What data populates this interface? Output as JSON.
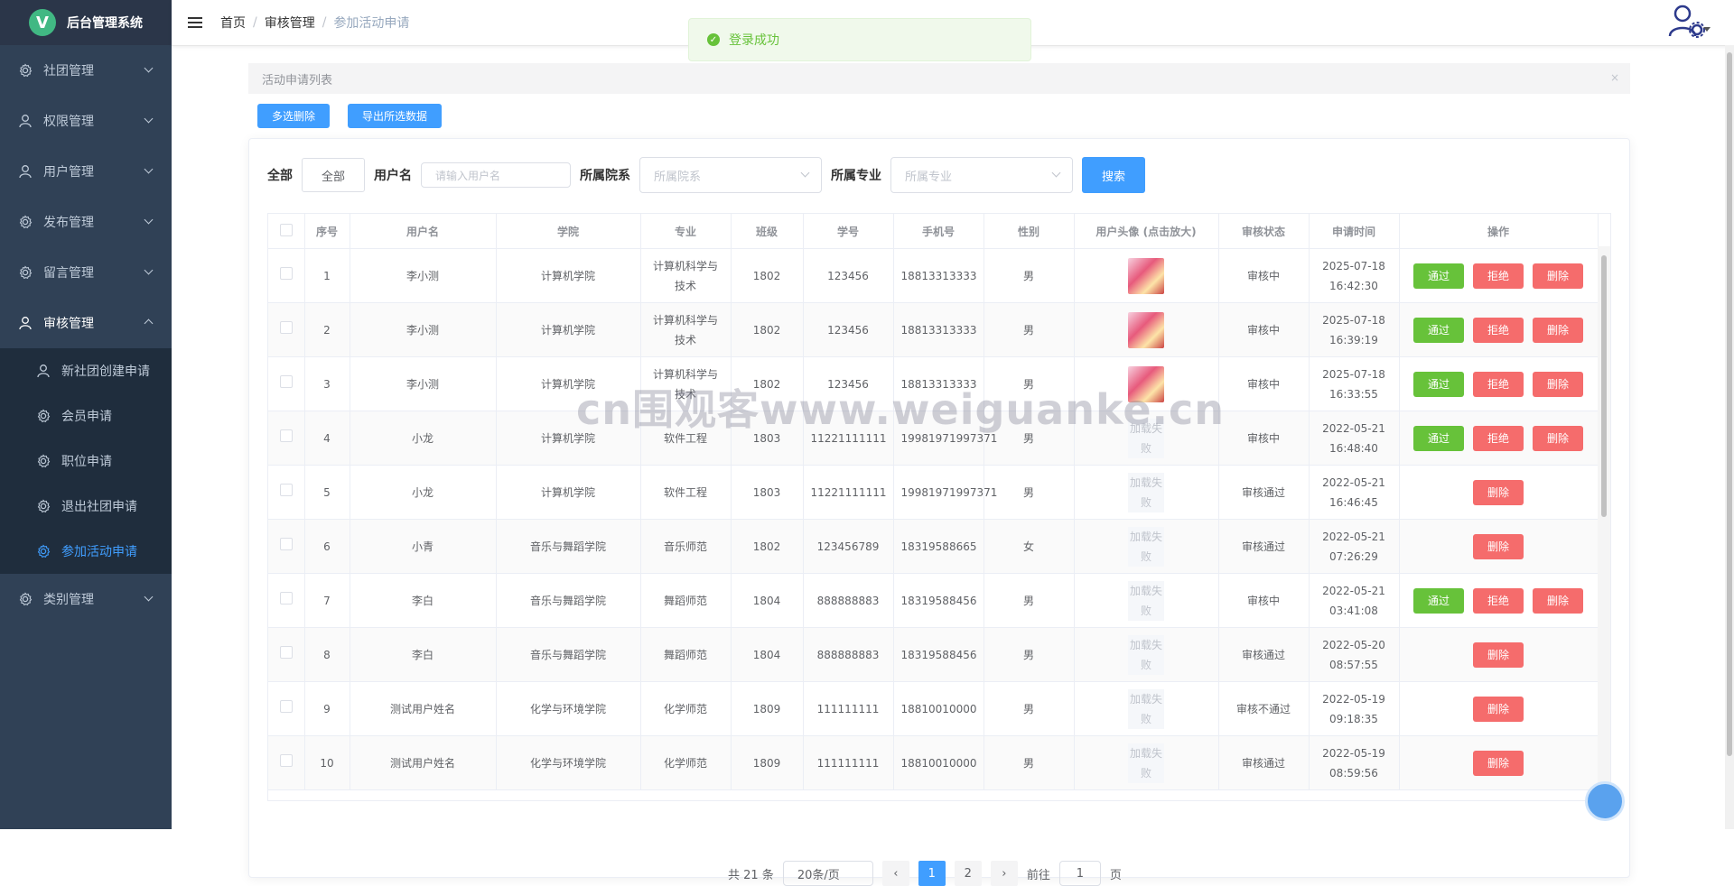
{
  "app": {
    "title": "后台管理系统",
    "logo_letter": "V"
  },
  "sidebar": {
    "items": [
      {
        "label": "社团管理",
        "icon": "gear-icon",
        "open": false
      },
      {
        "label": "权限管理",
        "icon": "user-icon",
        "open": false
      },
      {
        "label": "用户管理",
        "icon": "user-icon",
        "open": false
      },
      {
        "label": "发布管理",
        "icon": "gear-icon",
        "open": false
      },
      {
        "label": "留言管理",
        "icon": "gear-icon",
        "open": false
      },
      {
        "label": "审核管理",
        "icon": "user-icon",
        "open": true
      },
      {
        "label": "类别管理",
        "icon": "gear-icon",
        "open": false
      }
    ],
    "sub_items": [
      {
        "label": "新社团创建申请",
        "icon": "user-icon"
      },
      {
        "label": "会员申请",
        "icon": "gear-icon"
      },
      {
        "label": "职位申请",
        "icon": "gear-icon"
      },
      {
        "label": "退出社团申请",
        "icon": "gear-icon"
      },
      {
        "label": "参加活动申请",
        "icon": "gear-icon",
        "active": true
      }
    ]
  },
  "breadcrumb": [
    "首页",
    "审核管理",
    "参加活动申请"
  ],
  "toast": {
    "text": "登录成功"
  },
  "panel": {
    "title": "活动申请列表",
    "close": "×"
  },
  "toolbar": {
    "batch_delete": "多选删除",
    "export": "导出所选数据"
  },
  "filters": {
    "all_label": "全部",
    "all_button": "全部",
    "username_label": "用户名",
    "username_placeholder": "请输入用户名",
    "college_label": "所属院系",
    "college_placeholder": "所属院系",
    "major_label": "所属专业",
    "major_placeholder": "所属专业",
    "search_button": "搜索"
  },
  "table": {
    "headers": [
      "序号",
      "用户名",
      "学院",
      "专业",
      "班级",
      "学号",
      "手机号",
      "性别",
      "用户头像 (点击放大)",
      "审核状态",
      "申请时间",
      "操作"
    ],
    "rows": [
      {
        "no": "1",
        "user": "李小测",
        "college": "计算机学院",
        "major": "计算机科学与技术",
        "cls": "1802",
        "sid": "123456",
        "phone": "18813313333",
        "gender": "男",
        "avatar": "image",
        "status": "审核中",
        "time": "2025-07-18 16:42:30",
        "ops": [
          "通过",
          "拒绝",
          "删除"
        ]
      },
      {
        "no": "2",
        "user": "李小测",
        "college": "计算机学院",
        "major": "计算机科学与技术",
        "cls": "1802",
        "sid": "123456",
        "phone": "18813313333",
        "gender": "男",
        "avatar": "image",
        "status": "审核中",
        "time": "2025-07-18 16:39:19",
        "ops": [
          "通过",
          "拒绝",
          "删除"
        ]
      },
      {
        "no": "3",
        "user": "李小测",
        "college": "计算机学院",
        "major": "计算机科学与技术",
        "cls": "1802",
        "sid": "123456",
        "phone": "18813313333",
        "gender": "男",
        "avatar": "image",
        "status": "审核中",
        "time": "2025-07-18 16:33:55",
        "ops": [
          "通过",
          "拒绝",
          "删除"
        ]
      },
      {
        "no": "4",
        "user": "小龙",
        "college": "计算机学院",
        "major": "软件工程",
        "cls": "1803",
        "sid": "11221111111",
        "phone": "19981971997371",
        "gender": "男",
        "avatar": "加载失败",
        "status": "审核中",
        "time": "2022-05-21 16:48:40",
        "ops": [
          "通过",
          "拒绝",
          "删除"
        ]
      },
      {
        "no": "5",
        "user": "小龙",
        "college": "计算机学院",
        "major": "软件工程",
        "cls": "1803",
        "sid": "11221111111",
        "phone": "19981971997371",
        "gender": "男",
        "avatar": "加载失败",
        "status": "审核通过",
        "time": "2022-05-21 16:46:45",
        "ops": [
          "删除"
        ]
      },
      {
        "no": "6",
        "user": "小青",
        "college": "音乐与舞蹈学院",
        "major": "音乐师范",
        "cls": "1802",
        "sid": "123456789",
        "phone": "18319588665",
        "gender": "女",
        "avatar": "加载失败",
        "status": "审核通过",
        "time": "2022-05-21 07:26:29",
        "ops": [
          "删除"
        ]
      },
      {
        "no": "7",
        "user": "李白",
        "college": "音乐与舞蹈学院",
        "major": "舞蹈师范",
        "cls": "1804",
        "sid": "888888883",
        "phone": "18319588456",
        "gender": "男",
        "avatar": "加载失败",
        "status": "审核中",
        "time": "2022-05-21 03:41:08",
        "ops": [
          "通过",
          "拒绝",
          "删除"
        ]
      },
      {
        "no": "8",
        "user": "李白",
        "college": "音乐与舞蹈学院",
        "major": "舞蹈师范",
        "cls": "1804",
        "sid": "888888883",
        "phone": "18319588456",
        "gender": "男",
        "avatar": "加载失败",
        "status": "审核通过",
        "time": "2022-05-20 08:57:55",
        "ops": [
          "删除"
        ]
      },
      {
        "no": "9",
        "user": "测试用户姓名",
        "college": "化学与环境学院",
        "major": "化学师范",
        "cls": "1809",
        "sid": "111111111",
        "phone": "18810010000",
        "gender": "男",
        "avatar": "加载失败",
        "status": "审核不通过",
        "time": "2022-05-19 09:18:35",
        "ops": [
          "删除"
        ]
      },
      {
        "no": "10",
        "user": "测试用户姓名",
        "college": "化学与环境学院",
        "major": "化学师范",
        "cls": "1809",
        "sid": "111111111",
        "phone": "18810010000",
        "gender": "男",
        "avatar": "加载失败",
        "status": "审核通过",
        "time": "2022-05-19 08:59:56",
        "ops": [
          "删除"
        ]
      }
    ]
  },
  "pagination": {
    "total": "共 21 条",
    "page_size": "20条/页",
    "pages": [
      "1",
      "2"
    ],
    "current": "1",
    "goto_label": "前往",
    "goto_value": "1",
    "goto_suffix": "页"
  },
  "watermark": "cn围观客www.weiguanke.cn",
  "colors": {
    "sidebar_bg": "#304156",
    "primary": "#409eff",
    "success": "#67c23a",
    "danger": "#f56c6c"
  }
}
